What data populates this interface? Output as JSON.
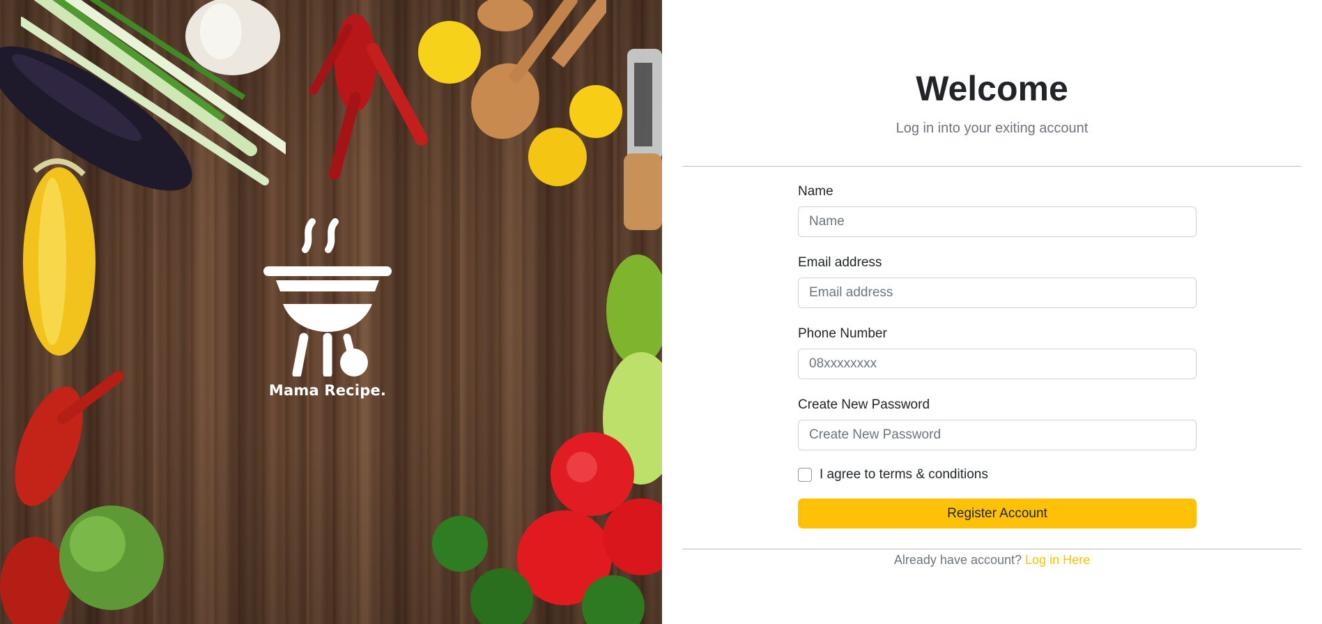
{
  "brand": {
    "name": "Mama Recipe.",
    "logo_icon": "grill-icon"
  },
  "header": {
    "title": "Welcome",
    "subtitle": "Log in into your exiting account"
  },
  "form": {
    "fields": [
      {
        "label": "Name",
        "placeholder": "Name",
        "value": ""
      },
      {
        "label": "Email address",
        "placeholder": "Email address",
        "value": ""
      },
      {
        "label": "Phone Number",
        "placeholder": "08xxxxxxxx",
        "value": ""
      },
      {
        "label": "Create New Password",
        "placeholder": "Create New Password",
        "value": ""
      }
    ],
    "terms_label": "I agree to terms & conditions",
    "terms_checked": false,
    "submit_label": "Register Account"
  },
  "footer": {
    "prompt": "Already have account?",
    "link_label": "Log in Here"
  },
  "colors": {
    "accent": "#ffc107",
    "text": "#212529",
    "muted": "#6c757d",
    "border": "#ced4da"
  }
}
